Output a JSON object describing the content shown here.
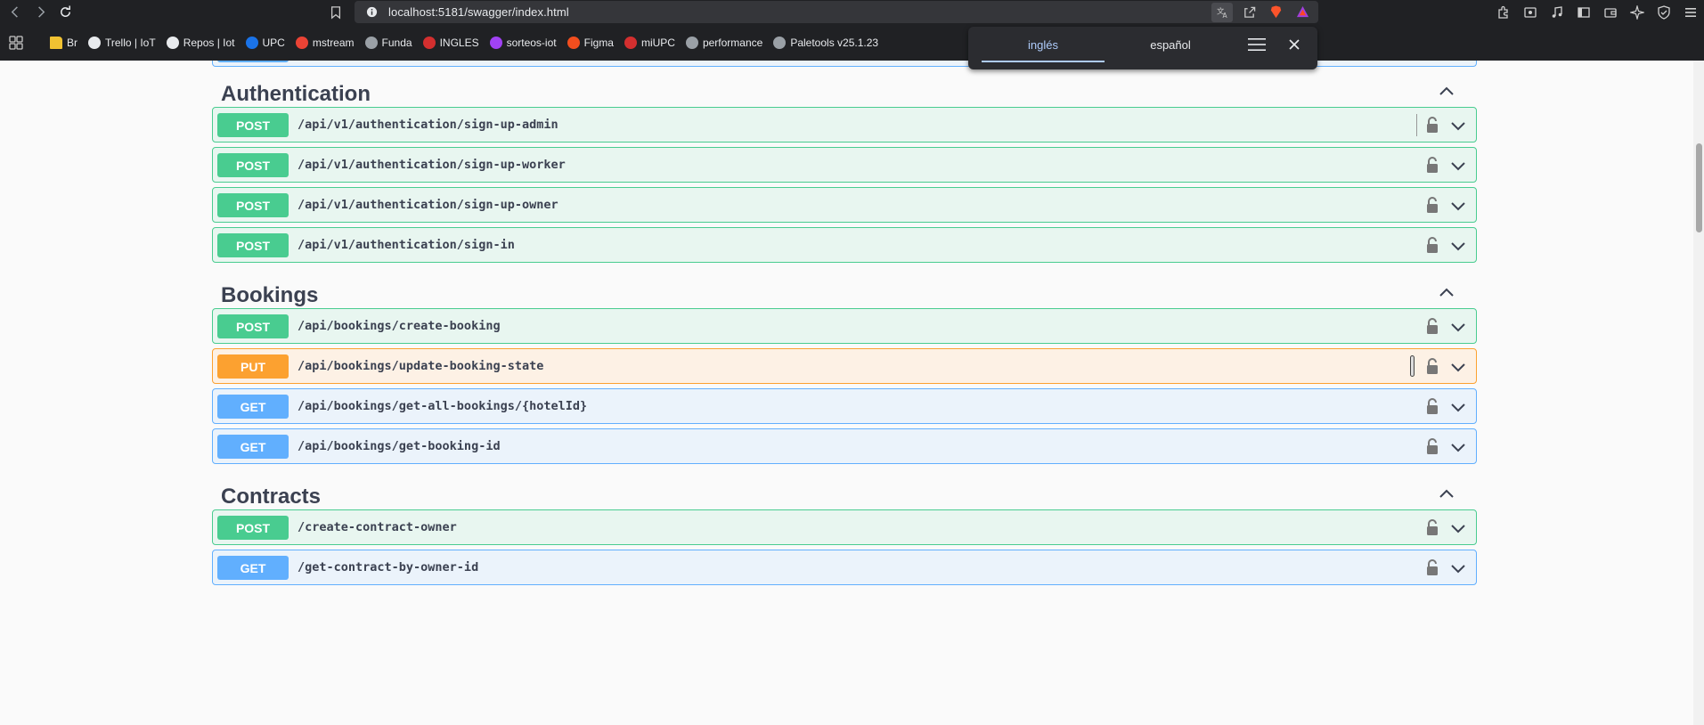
{
  "browser": {
    "url": "localhost:5181/swagger/index.html",
    "bookmarks": [
      {
        "label": "Br",
        "icon": "folder-icon",
        "color": "#f1c232"
      },
      {
        "label": "Trello | IoT",
        "icon": "trello-icon",
        "color": "#e8eaed"
      },
      {
        "label": "Repos | Iot",
        "icon": "github-icon",
        "color": "#e8eaed"
      },
      {
        "label": "UPC",
        "icon": "upc-icon",
        "color": "#1a73e8"
      },
      {
        "label": "mstream",
        "icon": "mstream-icon",
        "color": "#ea4335"
      },
      {
        "label": "Funda",
        "icon": "globe-icon",
        "color": "#9aa0a6"
      },
      {
        "label": "INGLES",
        "icon": "upc-red-icon",
        "color": "#d32f2f"
      },
      {
        "label": "sorteos-iot",
        "icon": "sorteos-icon",
        "color": "#a142f4"
      },
      {
        "label": "Figma",
        "icon": "figma-icon",
        "color": "#f24e1e"
      },
      {
        "label": "miUPC",
        "icon": "upc-red-icon",
        "color": "#d32f2f"
      },
      {
        "label": "performance",
        "icon": "globe-icon",
        "color": "#9aa0a6"
      },
      {
        "label": "Paletools v25.1.23",
        "icon": "globe-icon",
        "color": "#9aa0a6"
      }
    ]
  },
  "translate": {
    "lang_from": "inglés",
    "lang_to": "español"
  },
  "colors": {
    "post": "#49cc90",
    "put": "#fca130",
    "get": "#61affe"
  },
  "sections": [
    {
      "title": "Authentication",
      "operations": [
        {
          "method": "POST",
          "path": "/api/v1/authentication/sign-up-admin"
        },
        {
          "method": "POST",
          "path": "/api/v1/authentication/sign-up-worker"
        },
        {
          "method": "POST",
          "path": "/api/v1/authentication/sign-up-owner"
        },
        {
          "method": "POST",
          "path": "/api/v1/authentication/sign-in"
        }
      ]
    },
    {
      "title": "Bookings",
      "operations": [
        {
          "method": "POST",
          "path": "/api/bookings/create-booking"
        },
        {
          "method": "PUT",
          "path": "/api/bookings/update-booking-state"
        },
        {
          "method": "GET",
          "path": "/api/bookings/get-all-bookings/{hotelId}"
        },
        {
          "method": "GET",
          "path": "/api/bookings/get-booking-id"
        }
      ]
    },
    {
      "title": "Contracts",
      "operations": [
        {
          "method": "POST",
          "path": "/create-contract-owner"
        },
        {
          "method": "GET",
          "path": "/get-contract-by-owner-id"
        }
      ]
    }
  ]
}
